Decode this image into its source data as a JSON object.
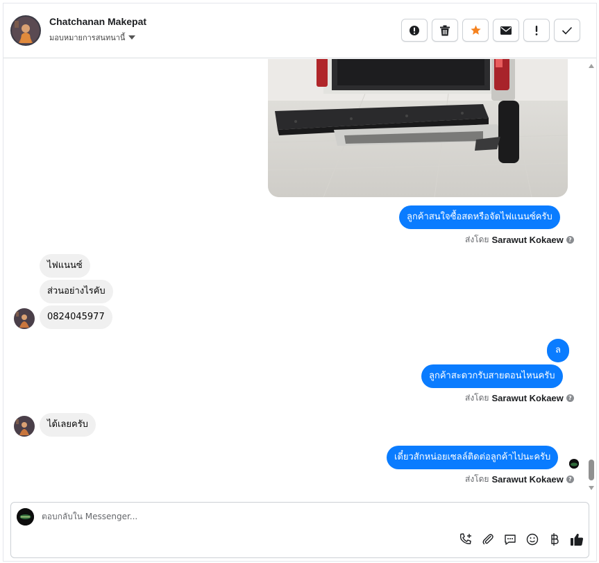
{
  "header": {
    "contact_name": "Chatchanan Makepat",
    "assign_label": "มอบหมายการสนทนานี้",
    "actions": [
      {
        "icon": "alert-circle-icon",
        "label": "Mark as spam"
      },
      {
        "icon": "trash-icon",
        "label": "Delete"
      },
      {
        "icon": "star-icon",
        "label": "Follow up"
      },
      {
        "icon": "envelope-icon",
        "label": "Mark as unread"
      },
      {
        "icon": "exclamation-icon",
        "label": "Mark as important"
      },
      {
        "icon": "check-icon",
        "label": "Mark as done"
      }
    ],
    "star_color": "#f5821f"
  },
  "messages": {
    "out_1": "ลูกค้าสนใจซื้อสดหรือจัดไฟแนนซ์ครับ",
    "sent_by_prefix": "ส่งโดย",
    "agent_name": "Sarawut Kokaew",
    "in_1": "ไฟแนนซ์",
    "in_2": "ส่วนอย่างไรคับ",
    "in_3": "0824045977",
    "out_2": "ล",
    "out_3": "ลูกค้าสะดวกรับสายตอนไหนครับ",
    "in_4": "ได้เลยครับ",
    "out_4": "เดี๋ยวสักหน่อยเซลล์ติดต่อลูกค้าไปนะครับ"
  },
  "composer": {
    "placeholder": "ตอบกลับใน Messenger...",
    "tools": [
      "call-add-icon",
      "attachment-icon",
      "saved-reply-icon",
      "emoji-icon",
      "baht-payment-icon",
      "like-icon"
    ]
  },
  "colors": {
    "outgoing_bubble": "#0a7cff",
    "incoming_bubble": "#f0f0f0"
  }
}
